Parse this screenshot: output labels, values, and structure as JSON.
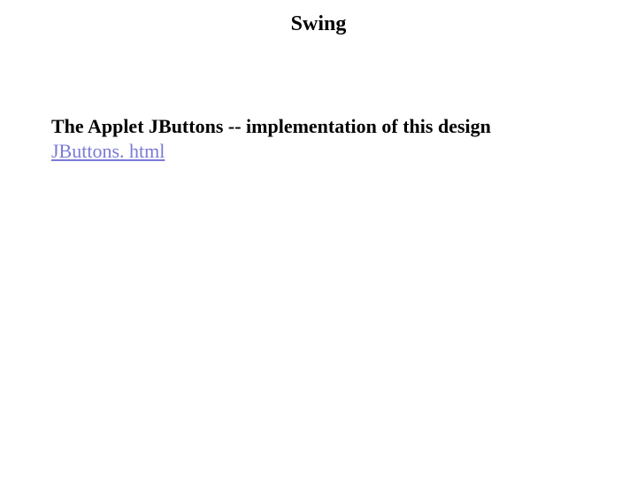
{
  "title": "Swing",
  "subtitle": "The Applet  JButtons  -- implementation of this design",
  "link_text": "JButtons. html"
}
